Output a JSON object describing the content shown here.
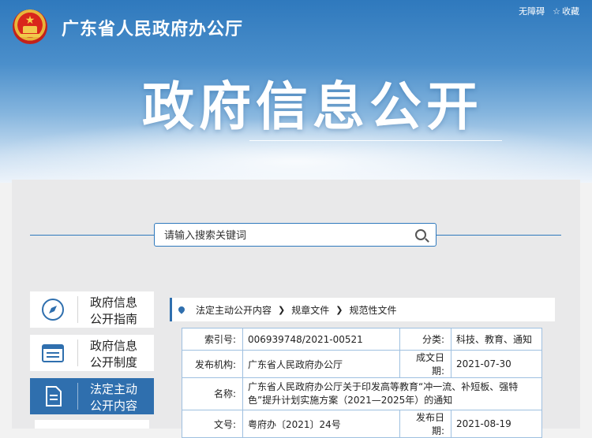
{
  "header": {
    "site_title": "广东省人民政府办公厅",
    "accessibility_label": "无障碍",
    "favorite_label": "收藏",
    "banner_title": "政府信息公开"
  },
  "search": {
    "placeholder": "请输入搜索关键词"
  },
  "sidebar": {
    "items": [
      {
        "label": "政府信息公开指南",
        "icon": "compass-icon",
        "active": false
      },
      {
        "label": "政府信息公开制度",
        "icon": "document-list-icon",
        "active": false
      },
      {
        "label": "法定主动公开内容",
        "icon": "file-icon",
        "active": true
      }
    ]
  },
  "breadcrumb": {
    "items": [
      "法定主动公开内容",
      "规章文件",
      "规范性文件"
    ]
  },
  "meta": {
    "index_label": "索引号:",
    "index_value": "006939748/2021-00521",
    "category_label": "分类:",
    "category_value": "科技、教育、通知",
    "publisher_label": "发布机构:",
    "publisher_value": "广东省人民政府办公厅",
    "written_date_label": "成文日期:",
    "written_date_value": "2021-07-30",
    "name_label": "名称:",
    "name_value": "广东省人民政府办公厅关于印发高等教育“冲一流、补短板、强特色”提升计划实施方案（2021—2025年）的通知",
    "doc_no_label": "文号:",
    "doc_no_value": "粤府办〔2021〕24号",
    "publish_date_label": "发布日期:",
    "publish_date_value": "2021-08-19"
  },
  "colors": {
    "primary": "#2f6fae",
    "accent_blue": "#2f79bd",
    "border_blue": "#9fc0e0"
  }
}
